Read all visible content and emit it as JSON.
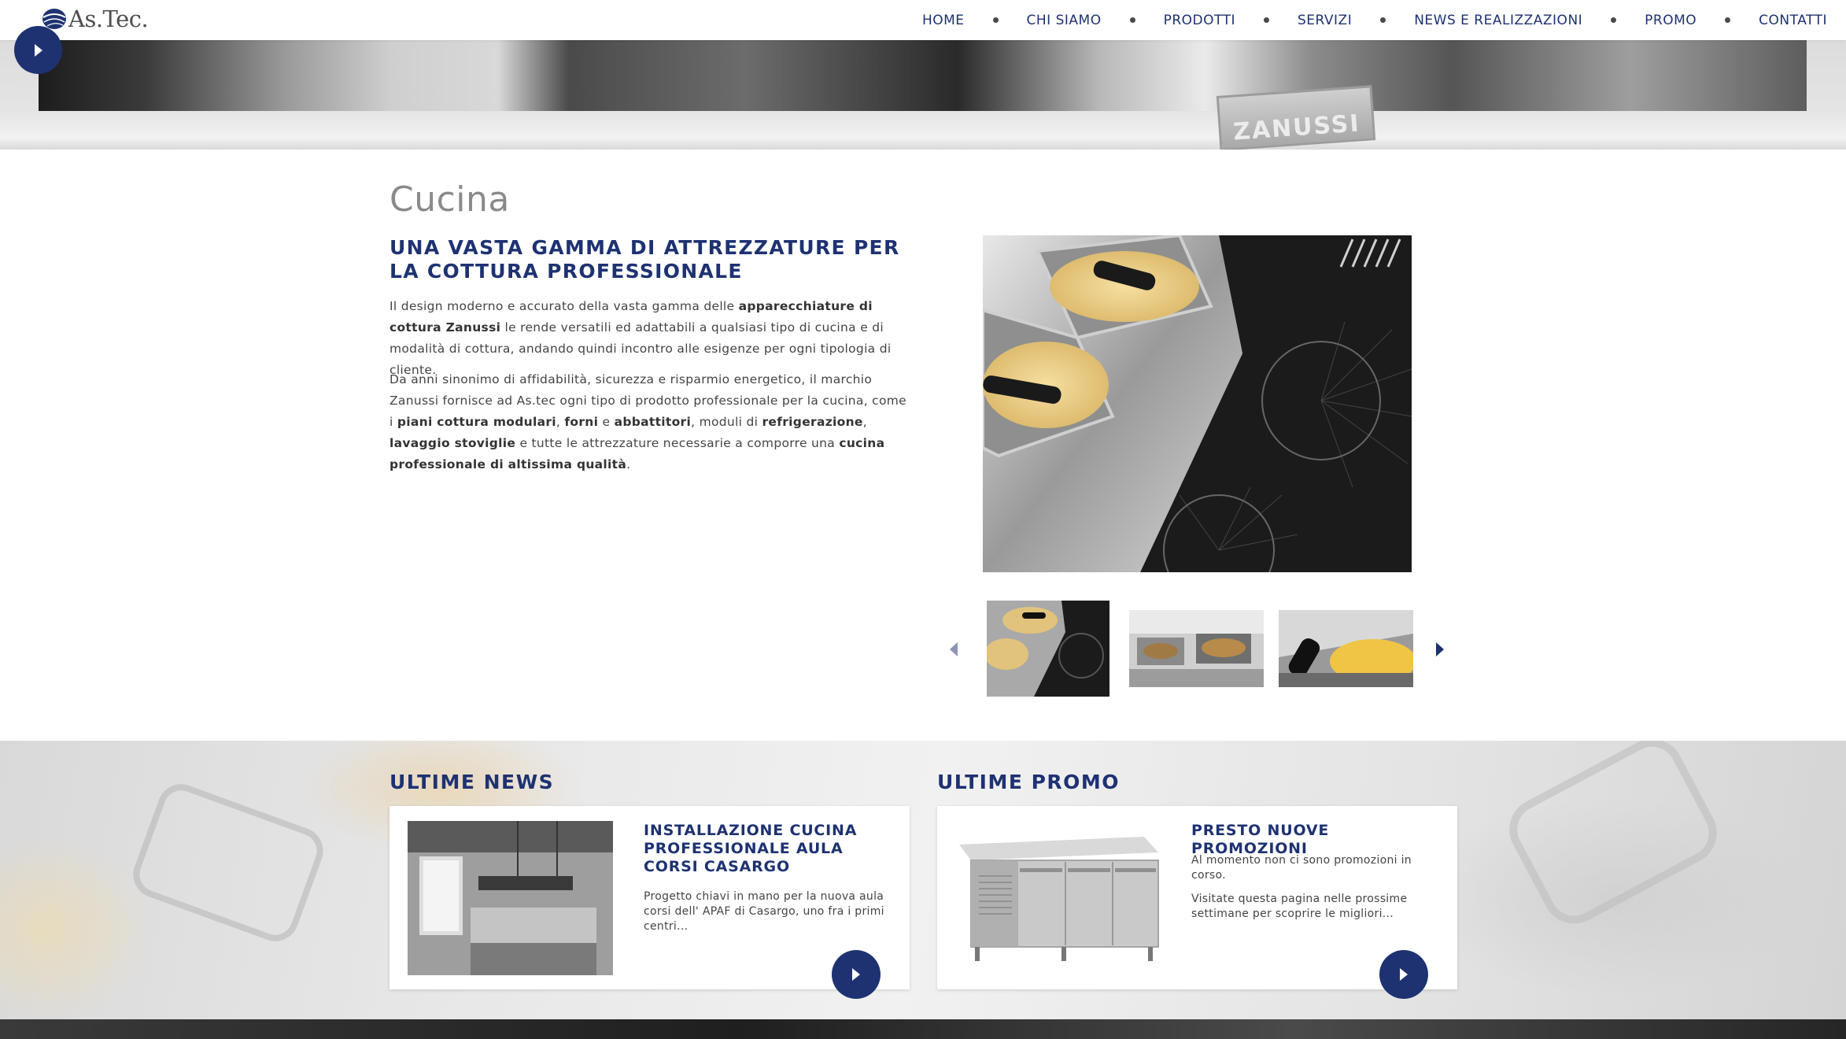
{
  "header": {
    "logo_text": "As.Tec.",
    "nav": [
      {
        "label": "HOME"
      },
      {
        "label": "CHI SIAMO"
      },
      {
        "label": "PRODOTTI"
      },
      {
        "label": "SERVIZI"
      },
      {
        "label": "NEWS E REALIZZAZIONI"
      },
      {
        "label": "PROMO"
      },
      {
        "label": "CONTATTI"
      }
    ]
  },
  "hero": {
    "badge_text": "ZANUSSI"
  },
  "main": {
    "title": "Cucina",
    "subtitle": "UNA VASTA GAMMA DI ATTREZZATURE PER LA COTTURA PROFESSIONALE",
    "p1": [
      {
        "t": "Il design moderno e accurato della vasta gamma delle ",
        "b": false
      },
      {
        "t": "apparecchiature di cottura Zanussi",
        "b": true
      },
      {
        "t": " le rende versatili ed adattabili a qualsiasi tipo di cucina e di modalità di cottura, andando quindi incontro alle esigenze per ogni tipologia di cliente.",
        "b": false
      }
    ],
    "p2": [
      {
        "t": "Da anni sinonimo di affidabilità, sicurezza e risparmio energetico, il marchio Zanussi fornisce ad As.tec ogni tipo di prodotto professionale per la cucina, come i ",
        "b": false
      },
      {
        "t": "piani cottura modulari",
        "b": true
      },
      {
        "t": ", ",
        "b": false
      },
      {
        "t": "forni",
        "b": true
      },
      {
        "t": " e ",
        "b": false
      },
      {
        "t": "abbattitori",
        "b": true
      },
      {
        "t": ", moduli di ",
        "b": false
      },
      {
        "t": "refrigerazione",
        "b": true
      },
      {
        "t": ", ",
        "b": false
      },
      {
        "t": "lavaggio stoviglie",
        "b": true
      },
      {
        "t": " e tutte le attrezzature necessarie a comporre una ",
        "b": false
      },
      {
        "t": "cucina professionale di altissima qualità",
        "b": true
      },
      {
        "t": ".",
        "b": false
      }
    ],
    "gallery": {
      "thumbnail_count": 3
    }
  },
  "news": {
    "section_title": "ULTIME NEWS",
    "card_title": "INSTALLAZIONE CUCINA PROFESSIONALE AULA CORSI CASARGO",
    "card_text": "Progetto chiavi in mano per la nuova aula corsi dell' APAF di Casargo, uno fra i primi centri..."
  },
  "promo": {
    "section_title": "ULTIME PROMO",
    "card_title": "PRESTO NUOVE PROMOZIONI",
    "card_text_1": "Al momento non ci sono promozioni in corso.",
    "card_text_2": "Visitate questa pagina nelle prossime settimane per scoprire le migliori..."
  },
  "colors": {
    "brand_blue": "#1e3272",
    "nav_dot": "#4a4a4a",
    "title_grey": "#8a8a8a"
  },
  "icons": {
    "hero_arrow": "chevron-right-icon",
    "gallery_prev": "caret-left-icon",
    "gallery_next": "caret-right-icon",
    "card_button": "chevron-right-icon"
  }
}
